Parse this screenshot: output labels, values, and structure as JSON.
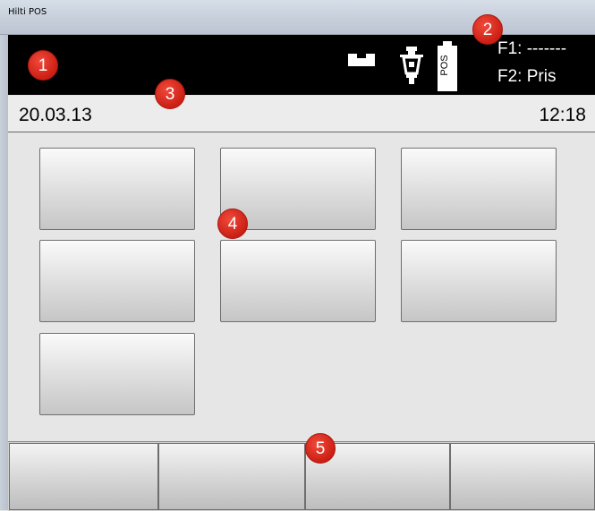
{
  "window": {
    "title": "Hilti POS"
  },
  "status_bar": {
    "battery_label": "POS",
    "f1_label": "F1: -------",
    "f2_label": "F2: Pris"
  },
  "date_bar": {
    "date": "20.03.13",
    "time": "12:18"
  },
  "menu_buttons": [
    "",
    "",
    "",
    "",
    "",
    "",
    ""
  ],
  "softkeys": [
    "",
    "",
    "",
    ""
  ],
  "callouts": [
    "1",
    "2",
    "3",
    "4",
    "5"
  ],
  "colors": {
    "status_bar_bg": "#000000",
    "callout_red": "#e02a1e"
  }
}
